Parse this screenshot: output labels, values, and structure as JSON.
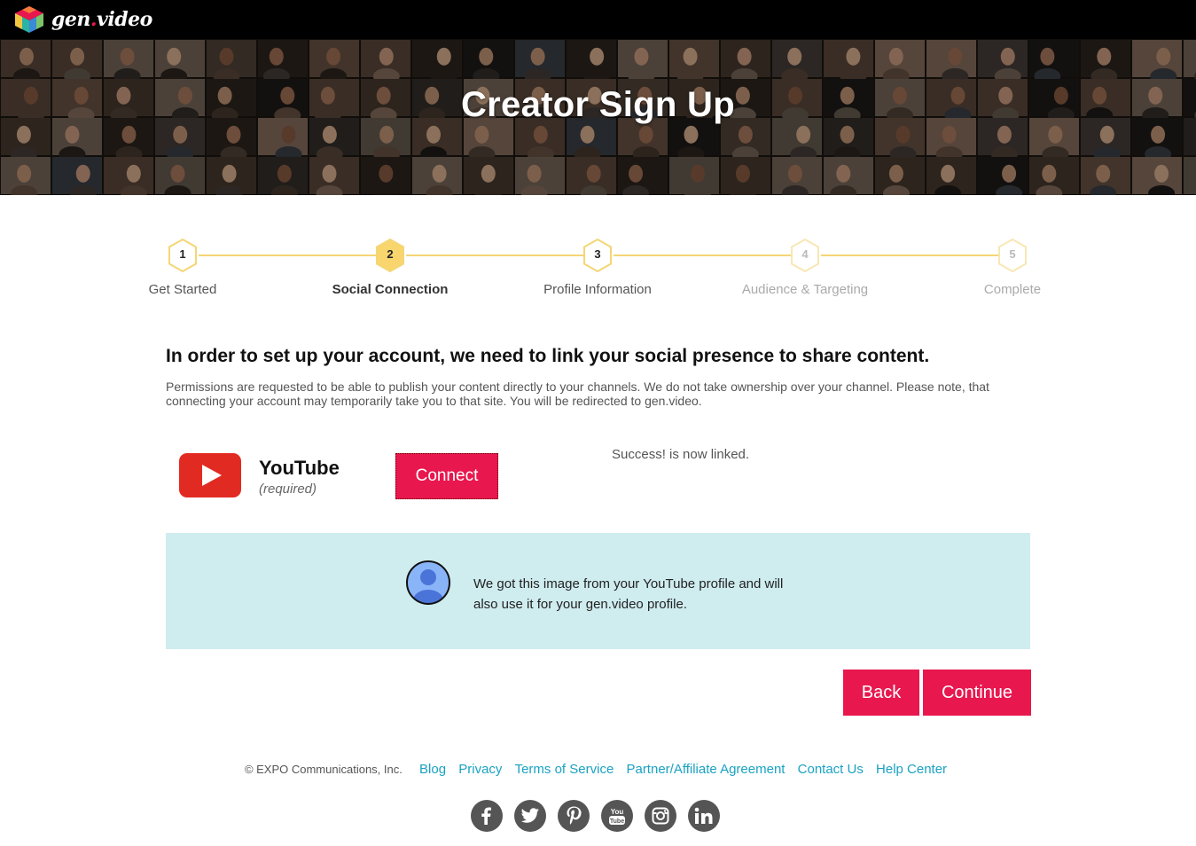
{
  "brand": {
    "name_part1": "gen",
    "name_dot": ".",
    "name_part2": "video"
  },
  "hero": {
    "title": "Creator Sign Up"
  },
  "stepper": {
    "steps": [
      {
        "number": "1",
        "label": "Get Started",
        "state": "done"
      },
      {
        "number": "2",
        "label": "Social Connection",
        "state": "active"
      },
      {
        "number": "3",
        "label": "Profile Information",
        "state": "done"
      },
      {
        "number": "4",
        "label": "Audience & Targeting",
        "state": "future"
      },
      {
        "number": "5",
        "label": "Complete",
        "state": "future"
      }
    ]
  },
  "content": {
    "headline": "In order to set up your account, we need to link your social presence to share content.",
    "subtext": "Permissions are requested to be able to publish your content directly to your channels. We do not take ownership over your channel. Please note, that connecting your account may temporarily take you to that site. You will be redirected to gen.video."
  },
  "youtube": {
    "name": "YouTube",
    "required_label": "(required)",
    "connect_label": "Connect",
    "status_text": "Success! is now linked."
  },
  "info_box": {
    "message": "We got this image from your YouTube profile and will also use it for your gen.video profile."
  },
  "actions": {
    "back_label": "Back",
    "continue_label": "Continue"
  },
  "footer": {
    "copyright": "© EXPO Communications, Inc.",
    "links": [
      "Blog",
      "Privacy",
      "Terms of Service",
      "Partner/Affiliate Agreement",
      "Contact Us",
      "Help Center"
    ],
    "social_icons": [
      "facebook-icon",
      "twitter-icon",
      "pinterest-icon",
      "youtube-icon",
      "instagram-icon",
      "linkedin-icon"
    ]
  },
  "colors": {
    "accent": "#e8174e",
    "step_line": "#f4d675",
    "active_step": "#f9d56e",
    "info_bg": "#cfecef",
    "link": "#1aa2c2"
  }
}
